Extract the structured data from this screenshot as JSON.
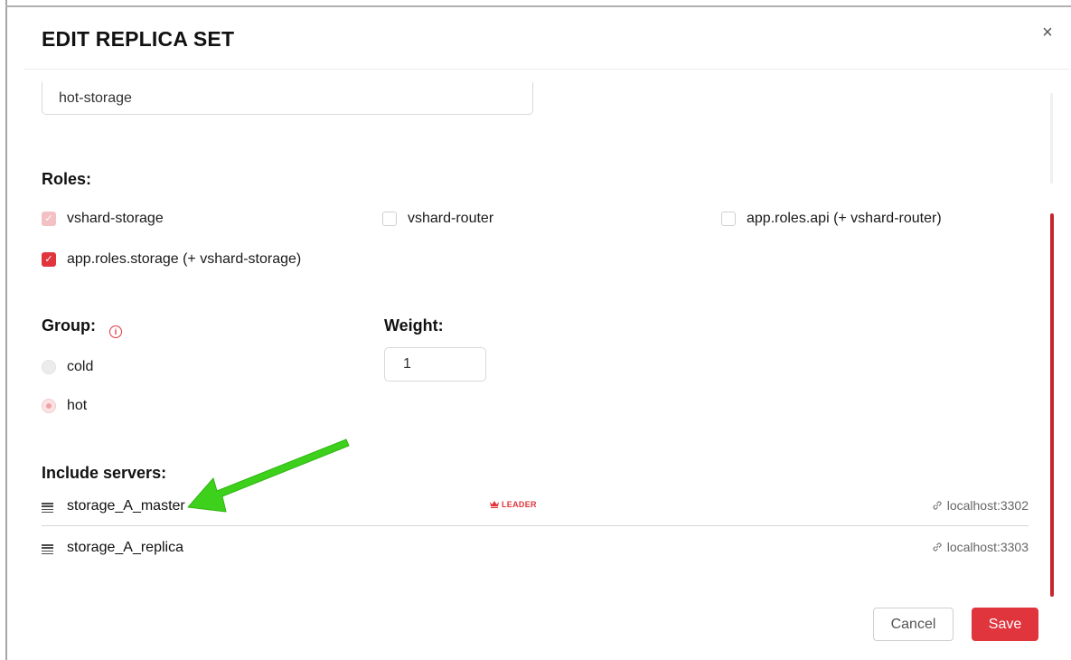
{
  "dialog": {
    "title": "EDIT REPLICA SET",
    "close_symbol": "×"
  },
  "alias_input": {
    "value": "hot-storage"
  },
  "roles": {
    "label": "Roles:",
    "items": [
      {
        "label": "vshard-storage",
        "checked": true,
        "disabled": true
      },
      {
        "label": "vshard-router",
        "checked": false,
        "disabled": false
      },
      {
        "label": "app.roles.api (+ vshard-router)",
        "checked": false,
        "disabled": false
      },
      {
        "label": "app.roles.storage (+ vshard-storage)",
        "checked": true,
        "disabled": false
      }
    ]
  },
  "group": {
    "label": "Group:",
    "info_icon": "info-icon",
    "options": [
      {
        "label": "cold",
        "selected": false
      },
      {
        "label": "hot",
        "selected": true
      }
    ]
  },
  "weight": {
    "label": "Weight:",
    "value": "1"
  },
  "servers": {
    "label": "Include servers:",
    "items": [
      {
        "name": "storage_A_master",
        "badge": "LEADER",
        "uri": "localhost:3302"
      },
      {
        "name": "storage_A_replica",
        "badge": "",
        "uri": "localhost:3303"
      }
    ]
  },
  "footer": {
    "cancel_label": "Cancel",
    "save_label": "Save"
  },
  "colors": {
    "accent": "#e0353d",
    "annotation_arrow": "#3dd11b"
  }
}
